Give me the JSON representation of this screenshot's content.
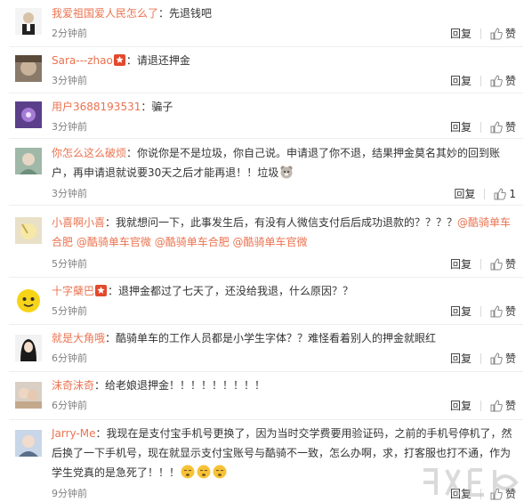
{
  "actions": {
    "reply": "回复",
    "like": "赞"
  },
  "comments": [
    {
      "user": "我爱祖国爱人民怎么了",
      "colon": "：",
      "text": "先退钱吧",
      "time": "2分钟前",
      "likes": ""
    },
    {
      "user": "Sara---zhao",
      "colon": "：",
      "text": "请退还押金",
      "time": "3分钟前",
      "likes": ""
    },
    {
      "user": "用户3688193531",
      "colon": "：",
      "text": "骗子",
      "time": "3分钟前",
      "likes": ""
    },
    {
      "user": "你怎么这么破烦",
      "colon": "：",
      "text1": "你说你是不是垃圾，你自己说。申请退了你不退，结果押金莫名其妙的回到账",
      "text2": "户，再申请退就说要30天之后才能再退！！垃圾",
      "time": "3分钟前",
      "likes": "1"
    },
    {
      "user": "小喜啊小喜",
      "colon": "：",
      "text1": "我就想问一下，此事发生后，有没有人微信支付后后成功退款的？？？？",
      "mention1": "@酷骑单车",
      "mention2": "合肥",
      "mention3": "@酷骑单车官微",
      "mention4": "@酷骑单车合肥",
      "mention5": "@酷骑单车官微",
      "time": "5分钟前",
      "likes": ""
    },
    {
      "user": "十字蘖巴",
      "colon": "：",
      "text": "退押金都过了七天了，还没给我退，什么原因？？",
      "time": "5分钟前",
      "likes": ""
    },
    {
      "user": "就是大角哦",
      "colon": "：",
      "text": "酷骑单车的工作人员都是小学生字体？？难怪看着别人的押金就眼红",
      "time": "6分钟前",
      "likes": ""
    },
    {
      "user": "沫奇沫奇",
      "colon": "：",
      "text": "给老娘退押金！！！！！！！！！",
      "time": "6分钟前",
      "likes": ""
    },
    {
      "user": "Jarry-Me",
      "colon": "：",
      "text1": "我现在是支付宝手机号更换了，因为当时交学费要用验证码，之前的手机号停机了，然",
      "text2": "后换了一下手机号，现在就显示支付宝账号与酷骑不一致，怎么办啊，求，打客服也打不通，作为",
      "text3": "学生党真的是急死了！！！",
      "time": "9分钟前",
      "likes": ""
    }
  ],
  "colors": {
    "username": "#eb7350",
    "text": "#333333",
    "time": "#808080",
    "vip_badge": "#e2492d"
  }
}
